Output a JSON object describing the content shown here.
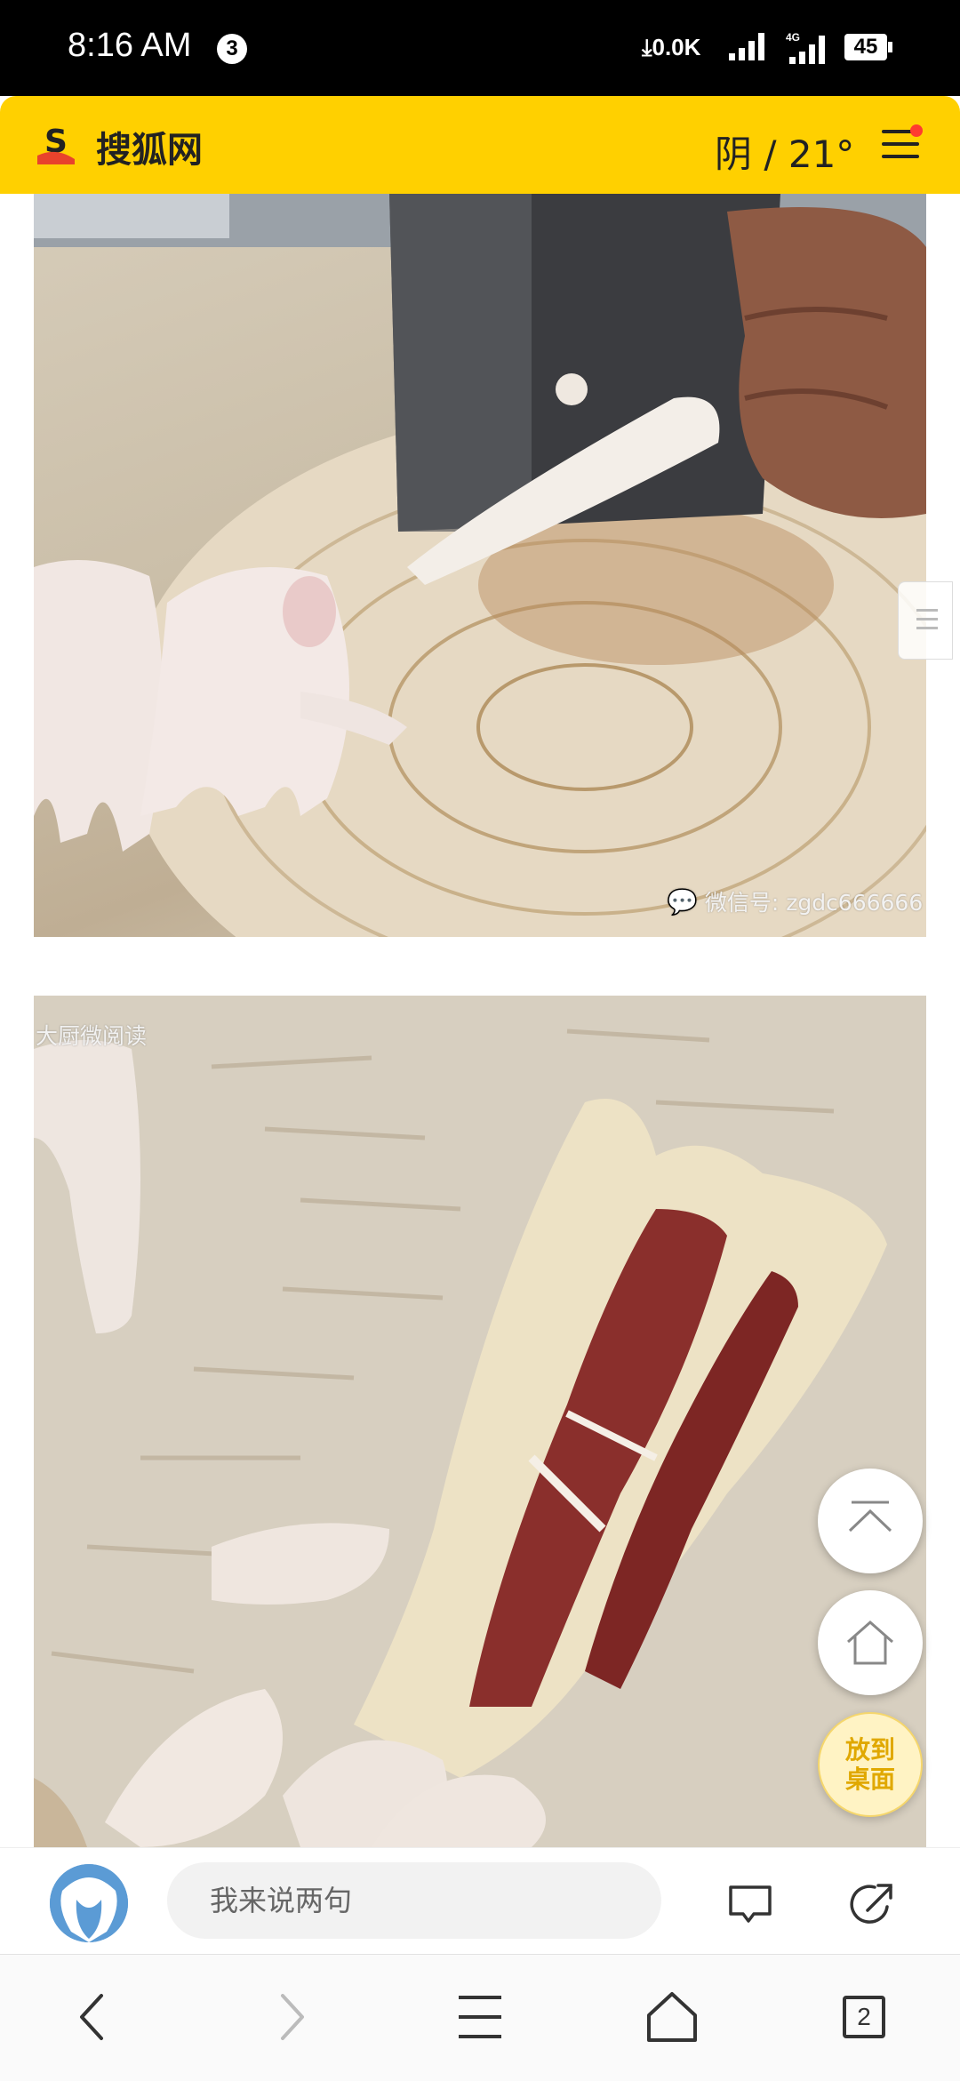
{
  "status_bar": {
    "time": "8:16 AM",
    "notification_count": "3",
    "network_speed": "0.0K",
    "network_type": "4G",
    "battery": "45"
  },
  "header": {
    "site_name": "搜狐网",
    "weather": "阴 / 21°",
    "brand_color": "#FFD000"
  },
  "content": {
    "photo1_watermark": "微信号: zgdc666666",
    "photo2_watermark": "大厨微阅读"
  },
  "floating": {
    "desktop_label": "放到桌面"
  },
  "comment_bar": {
    "placeholder": "我来说两句"
  },
  "nav": {
    "tab_count": "2"
  }
}
